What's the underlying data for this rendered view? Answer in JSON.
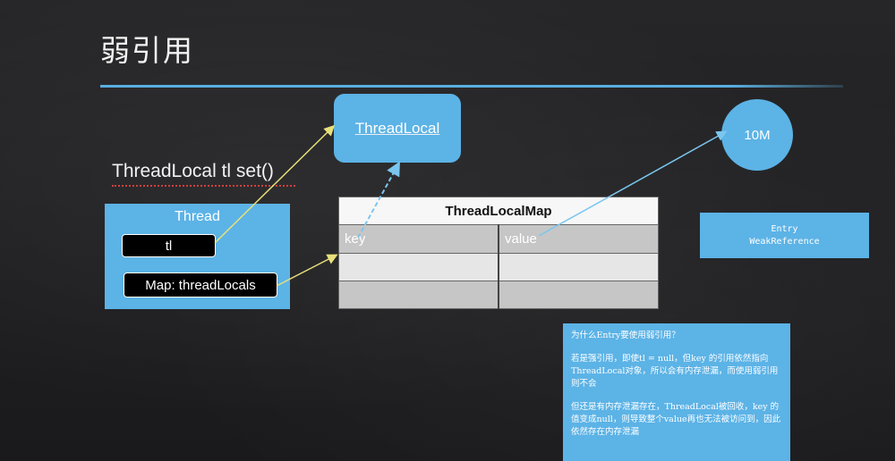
{
  "slide": {
    "title": "弱引用"
  },
  "diagram": {
    "threadlocal_box": "ThreadLocal",
    "memory_circle": "10M",
    "statement": "ThreadLocal tl set()",
    "thread": {
      "label": "Thread",
      "tl_field": "tl",
      "map_field": "Map: threadLocals"
    },
    "map_table": {
      "header": "ThreadLocalMap",
      "rows": [
        [
          "key",
          "value"
        ],
        [
          "",
          ""
        ],
        [
          "",
          ""
        ]
      ]
    },
    "entry_box": {
      "line1": "Entry",
      "line2": "WeakReference"
    },
    "colors": {
      "accent_blue": "#5cb3e6",
      "arrow_yellow": "#e8e07a",
      "arrow_blue": "#7ac6ef"
    }
  },
  "note": {
    "question": "为什么Entry要使用弱引用？",
    "para1": "若是强引用，即使tl = null，但key 的引用依然指向ThreadLocal对象，所以会有内存泄漏，而使用弱引用则不会",
    "para2": "但还是有内存泄漏存在，ThreadLocal被回收，key 的值变成null，则导致整个value再也无法被访问到，因此依然存在内存泄漏"
  }
}
